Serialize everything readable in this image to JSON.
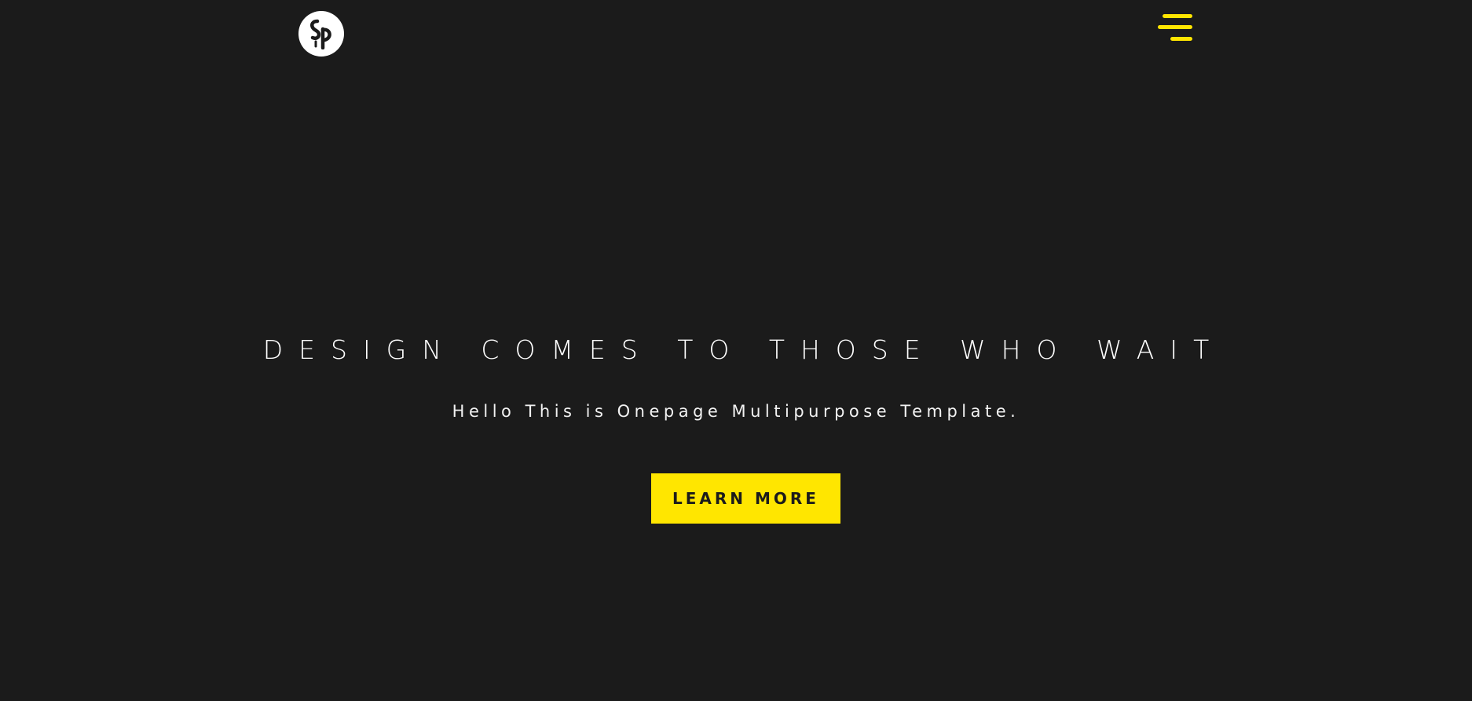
{
  "header": {
    "logo_icon": "sp-monogram-logo",
    "menu_icon": "hamburger-menu-icon"
  },
  "hero": {
    "title": "DESIGN COMES TO THOSE WHO WAIT",
    "subtitle": "Hello This is Onepage Multipurpose Template.",
    "cta_label": "LEARN MORE"
  },
  "colors": {
    "background": "#1b1b1b",
    "accent": "#ffe600",
    "text": "#ffffff"
  }
}
